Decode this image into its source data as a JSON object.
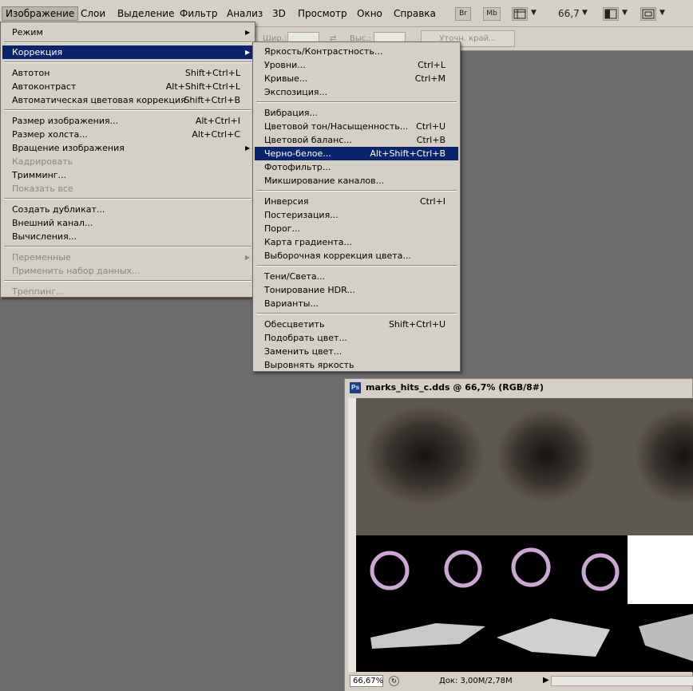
{
  "menubar": {
    "items": [
      {
        "label": "Изображение",
        "active": true
      },
      {
        "label": "Слои"
      },
      {
        "label": "Выделение"
      },
      {
        "label": "Фильтр"
      },
      {
        "label": "Анализ"
      },
      {
        "label": "3D"
      },
      {
        "label": "Просмотр"
      },
      {
        "label": "Окно"
      },
      {
        "label": "Справка"
      }
    ],
    "bridge_label": "Br",
    "minibridge_label": "Mb",
    "zoom_value": "66,7"
  },
  "options_bar": {
    "width_label": "Шир.:",
    "height_label": "Выс.:",
    "refine_edge_label": "Уточн. край..."
  },
  "image_menu": {
    "rows": [
      {
        "label": "Режим",
        "submenu": true
      },
      {
        "label": "Коррекция",
        "submenu": true,
        "highlighted": true
      },
      {
        "label": "Автотон",
        "shortcut": "Shift+Ctrl+L"
      },
      {
        "label": "Автоконтраст",
        "shortcut": "Alt+Shift+Ctrl+L"
      },
      {
        "label": "Автоматическая цветовая коррекция",
        "shortcut": "Shift+Ctrl+B"
      },
      {
        "label": "Размер изображения...",
        "shortcut": "Alt+Ctrl+I"
      },
      {
        "label": "Размер холста...",
        "shortcut": "Alt+Ctrl+C"
      },
      {
        "label": "Вращение изображения",
        "submenu": true
      },
      {
        "label": "Кадрировать",
        "disabled": true
      },
      {
        "label": "Тримминг..."
      },
      {
        "label": "Показать все",
        "disabled": true
      },
      {
        "label": "Создать дубликат..."
      },
      {
        "label": "Внешний канал..."
      },
      {
        "label": "Вычисления..."
      },
      {
        "label": "Переменные",
        "submenu": true,
        "disabled": true
      },
      {
        "label": "Применить набор данных...",
        "disabled": true
      },
      {
        "label": "Треппинг...",
        "disabled": true
      }
    ]
  },
  "adjust_menu": {
    "rows": [
      {
        "label": "Яркость/Контрастность..."
      },
      {
        "label": "Уровни...",
        "shortcut": "Ctrl+L"
      },
      {
        "label": "Кривые...",
        "shortcut": "Ctrl+M"
      },
      {
        "label": "Экспозиция..."
      },
      {
        "label": "Вибрация..."
      },
      {
        "label": "Цветовой тон/Насыщенность...",
        "shortcut": "Ctrl+U"
      },
      {
        "label": "Цветовой баланс...",
        "shortcut": "Ctrl+B"
      },
      {
        "label": "Черно-белое...",
        "shortcut": "Alt+Shift+Ctrl+B",
        "highlighted": true
      },
      {
        "label": "Фотофильтр..."
      },
      {
        "label": "Микширование каналов..."
      },
      {
        "label": "Инверсия",
        "shortcut": "Ctrl+I"
      },
      {
        "label": "Постеризация..."
      },
      {
        "label": "Порог..."
      },
      {
        "label": "Карта градиента..."
      },
      {
        "label": "Выборочная коррекция цвета..."
      },
      {
        "label": "Тени/Света..."
      },
      {
        "label": "Тонирование HDR..."
      },
      {
        "label": "Варианты..."
      },
      {
        "label": "Обесцветить",
        "shortcut": "Shift+Ctrl+U"
      },
      {
        "label": "Подобрать цвет..."
      },
      {
        "label": "Заменить цвет..."
      },
      {
        "label": "Выровнять яркость"
      }
    ]
  },
  "document": {
    "title": "marks_hits_c.dds @ 66,7% (RGB/8#)",
    "app_badge": "Ps",
    "zoom_field": "66,67%",
    "doc_info": "Док: 3,00M/2,78M"
  }
}
